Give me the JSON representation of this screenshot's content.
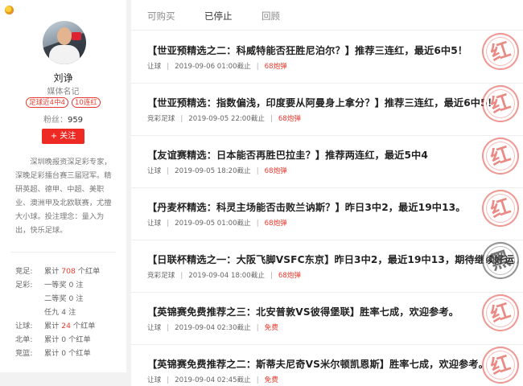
{
  "profile": {
    "name": "刘诤",
    "role": "媒体名记",
    "badges": [
      "足球近4中4",
      "10连红"
    ],
    "fans_label": "粉丝：",
    "fans_count": "959",
    "follow_label": "+ 关注",
    "bio": "深圳晚报资深足彩专家，深晚足彩擂台赛三届冠军。精研英超、德甲、中超、美职业、澳洲甲及北欧联赛，尤擅大小球。投注理念：量入为出，快乐足球。"
  },
  "stats": [
    {
      "label": "竞足:",
      "pre": "累计",
      "value": "708",
      "post": "个红单",
      "highlight": true
    },
    {
      "label": "足彩:",
      "pre": "一等奖",
      "value": "0",
      "post": "注",
      "highlight": false
    },
    {
      "label": "",
      "pre": "二等奖",
      "value": "0",
      "post": "注",
      "highlight": false
    },
    {
      "label": "",
      "pre": "任九",
      "value": "4",
      "post": "注",
      "highlight": false
    },
    {
      "label": "让球:",
      "pre": "累计",
      "value": "24",
      "post": "个红单",
      "highlight": true
    },
    {
      "label": "北单:",
      "pre": "累计",
      "value": "0",
      "post": "个红单",
      "highlight": false
    },
    {
      "label": "竞篮:",
      "pre": "累计",
      "value": "0",
      "post": "个红单",
      "highlight": false
    }
  ],
  "tabs": [
    {
      "label": "可购买",
      "active": false
    },
    {
      "label": "已停止",
      "active": true
    },
    {
      "label": "回顾",
      "active": false
    }
  ],
  "items": [
    {
      "title": "【世亚预精选之二：科威特能否狂胜尼泊尔？】推荐三连红，最近6中5！",
      "type": "让球",
      "time": "2019-09-06 01:00截止",
      "price": "68炮弹",
      "stamp": "红",
      "stamp_color": "red"
    },
    {
      "title": "【世亚预精选：指数偏浅，印度要从阿曼身上拿分？】推荐三连红，最近6中5！",
      "type": "竞彩足球",
      "time": "2019-09-05 22:00截止",
      "price": "68炮弹",
      "stamp": "红",
      "stamp_color": "red"
    },
    {
      "title": "【友谊赛精选：日本能否再胜巴拉圭？】推荐两连红，最近5中4",
      "type": "让球",
      "time": "2019-09-05 18:20截止",
      "price": "68炮弹",
      "stamp": "红",
      "stamp_color": "red"
    },
    {
      "title": "【丹麦杯精选：科灵主场能否击败兰讷斯？】昨日3中2，最近19中13。",
      "type": "让球",
      "time": "2019-09-05 01:00截止",
      "price": "68炮弹",
      "stamp": "红",
      "stamp_color": "red"
    },
    {
      "title": "【日联杯精选之一：大阪飞脚VSFC东京】昨日3中2，最近19中13，期待继续好运。",
      "type": "竞彩足球",
      "time": "2019-09-04 18:00截止",
      "price": "68炮弹",
      "stamp": "黑",
      "stamp_color": "black"
    },
    {
      "title": "【英锦赛免费推荐之三：北安普敦VS彼得堡联】胜率七成，欢迎参考。",
      "type": "让球",
      "time": "2019-09-04 02:30截止",
      "price": "免费",
      "stamp": "红",
      "stamp_color": "red"
    },
    {
      "title": "【英锦赛免费推荐之二：斯蒂夫尼奇VS米尔顿凯恩斯】胜率七成，欢迎参考。",
      "type": "让球",
      "time": "2019-09-04 02:45截止",
      "price": "免费",
      "stamp": "红",
      "stamp_color": "red"
    }
  ]
}
